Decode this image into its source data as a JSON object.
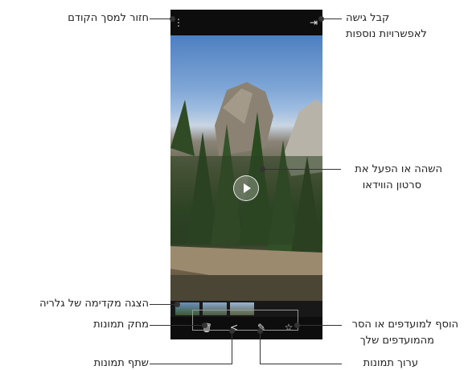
{
  "callouts": {
    "back": "חזור למסך הקודם",
    "more_options_1": "קבל גישה",
    "more_options_2": "לאפשרויות נוספות",
    "play_video_1": "השהה או הפעל את",
    "play_video_2": "סרטון הווידאו",
    "gallery_preview": "הצגה מקדימה של גלריה",
    "delete_images": "מחק תמונות",
    "favorites_1": "הוסף למועדפים או הסר",
    "favorites_2": "מהמועדפים שלך",
    "share_images": "שתף תמונות",
    "edit_images": "ערוך תמונות"
  },
  "icons": {
    "menu": "⋮",
    "share_top": "⇥",
    "delete": "🗑",
    "share": "<",
    "edit": "✎",
    "favorite": "☆"
  }
}
